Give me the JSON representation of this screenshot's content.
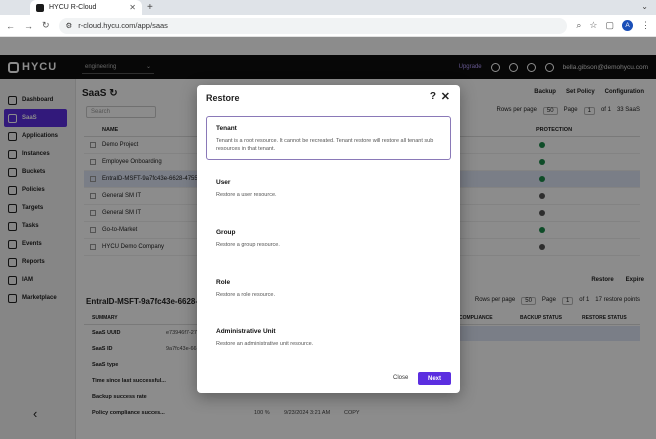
{
  "browser": {
    "tab_title": "HYCU R-Cloud",
    "new_tab": "+",
    "url": "r-cloud.hycu.com/app/saas",
    "profile_initial": "A"
  },
  "header": {
    "logo": "HYCU",
    "tenant": "engineering",
    "badge": "Upgrade",
    "user": "bella.gibson@demohycu.com"
  },
  "sidebar": {
    "items": [
      {
        "label": "Dashboard"
      },
      {
        "label": "SaaS"
      },
      {
        "label": "Applications"
      },
      {
        "label": "Instances"
      },
      {
        "label": "Buckets"
      },
      {
        "label": "Policies"
      },
      {
        "label": "Targets"
      },
      {
        "label": "Tasks"
      },
      {
        "label": "Events"
      },
      {
        "label": "Reports"
      },
      {
        "label": "IAM"
      },
      {
        "label": "Marketplace"
      }
    ]
  },
  "main": {
    "title": "SaaS",
    "actions": {
      "backup": "Backup",
      "set_policy": "Set Policy",
      "configuration": "Configuration"
    },
    "search_placeholder": "Search",
    "rows_per_page_label": "Rows per page",
    "rows_per_page": "50",
    "page_label": "Page",
    "page": "1",
    "of_label": "of 1",
    "count": "33 SaaS",
    "col_name": "NAME",
    "col_protection": "PROTECTION",
    "rows": [
      {
        "name": "Demo Project",
        "status": "ok"
      },
      {
        "name": "Employee Onboarding",
        "status": "ok"
      },
      {
        "name": "EntraID-MSFT-9a7fc43e-6628-4755-a0e6-",
        "status": "ok"
      },
      {
        "name": "General SM IT",
        "status": "unknown"
      },
      {
        "name": "General SM IT",
        "status": "unknown"
      },
      {
        "name": "Go-to-Market",
        "status": "ok"
      },
      {
        "name": "HYCU Demo Company",
        "status": "unknown"
      }
    ]
  },
  "lower": {
    "restore": "Restore",
    "expire": "Expire",
    "title": "EntraID-MSFT-9a7fc43e-6628-475",
    "rows_per_page_label": "Rows per page",
    "rows_per_page": "50",
    "page_label": "Page",
    "page": "1",
    "of_label": "of 1",
    "count": "17 restore points",
    "summary_label": "SUMMARY",
    "col_compliance": "COMPLIANCE",
    "col_backup": "BACKUP STATUS",
    "col_restore": "RESTORE STATUS",
    "summary": [
      {
        "key": "SaaS UUID",
        "value": "e73946f7-27"
      },
      {
        "key": "SaaS ID",
        "value": "9a7fc43e-66"
      },
      {
        "key": "SaaS type",
        "value": ""
      },
      {
        "key": "Time since last successful...",
        "value": ""
      },
      {
        "key": "Backup success rate",
        "value": ""
      },
      {
        "key": "Policy compliance succes...",
        "value": "100 %"
      }
    ],
    "last_date": "9/23/2024 3:21 AM",
    "last_tag": "COPY"
  },
  "modal": {
    "title": "Restore",
    "help": "?",
    "close": "✕",
    "options": [
      {
        "title": "Tenant",
        "desc": "Tenant is a root resource. It cannot be recreated. Tenant restore will restore all tenant sub resources in that tenant."
      },
      {
        "title": "User",
        "desc": "Restore a user resource."
      },
      {
        "title": "Group",
        "desc": "Restore a group resource."
      },
      {
        "title": "Role",
        "desc": "Restore a role resource."
      },
      {
        "title": "Administrative Unit",
        "desc": "Restore an administrative unit resource."
      }
    ],
    "close_label": "Close",
    "next_label": "Next"
  },
  "colors": {
    "accent": "#5b2ee0",
    "selected_border": "#8a79b8",
    "ok": "#1b8a4a"
  }
}
